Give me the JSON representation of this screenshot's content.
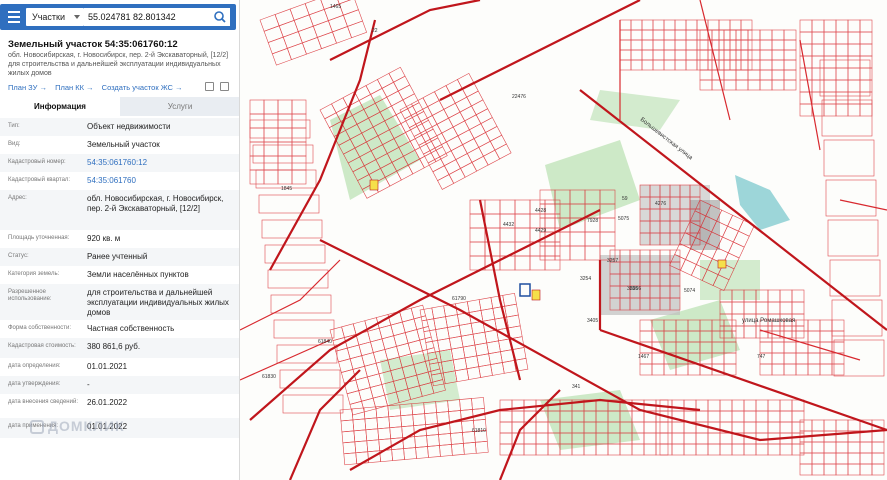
{
  "search": {
    "layer": "Участки",
    "query": "55.024781 82.801342"
  },
  "parcel": {
    "title": "Земельный участок 54:35:061760:12",
    "subtitle": "обл. Новосибирская, г. Новосибирск, пер. 2-й Экскаваторный, [12/2] для строительства и дальнейшей эксплуатации индивидуальных жилых домов"
  },
  "links": [
    "План ЗУ →",
    "План КК →",
    "Создать участок ЖС →"
  ],
  "tabs": {
    "info": "Информация",
    "services": "Услуги"
  },
  "rows": [
    {
      "label": "Тип:",
      "value": "Объект недвижимости"
    },
    {
      "label": "Вид:",
      "value": "Земельный участок"
    },
    {
      "label": "Кадастровый номер:",
      "value": "54:35:061760:12"
    },
    {
      "label": "Кадастровый квартал:",
      "value": "54:35:061760"
    },
    {
      "label": "Адрес:",
      "value": "обл. Новосибирская, г. Новосибирск, пер. 2-й Экскаваторный, [12/2]"
    },
    {
      "label": "Площадь уточненная:",
      "value": "920 кв. м"
    },
    {
      "label": "Статус:",
      "value": "Ранее учтенный"
    },
    {
      "label": "Категория земель:",
      "value": "Земли населённых пунктов"
    },
    {
      "label": "Разрешенное использование:",
      "value": "для строительства и дальнейшей эксплуатации индивидуальных жилых домов"
    },
    {
      "label": "Форма собственности:",
      "value": "Частная собственность"
    },
    {
      "label": "Кадастровая стоимость:",
      "value": "380 861,6 руб."
    },
    {
      "label": "дата определения:",
      "value": "01.01.2021"
    },
    {
      "label": "дата утверждения:",
      "value": "-"
    },
    {
      "label": "дата внесения сведений:",
      "value": "26.01.2022"
    },
    {
      "label": "дата применения:",
      "value": "01.01.2022"
    }
  ],
  "watermark": "ДОМКЛИК",
  "map_labels": [
    "1465",
    "22",
    "22476",
    "59",
    "5075",
    "4276",
    "5256",
    "3254",
    "4429",
    "4428",
    "3257",
    "3256",
    "5074",
    "61840",
    "61830",
    "61810",
    "341",
    "1845",
    "747",
    "1467",
    "3405",
    "4432",
    "7928",
    "61790",
    "Большевистская улица",
    "улица Ромашковая"
  ],
  "colors": {
    "accent": "#2f6fbf",
    "cadastre_line": "#d8292f",
    "green_area": "#8fcf86",
    "water": "#9dd6d9"
  }
}
